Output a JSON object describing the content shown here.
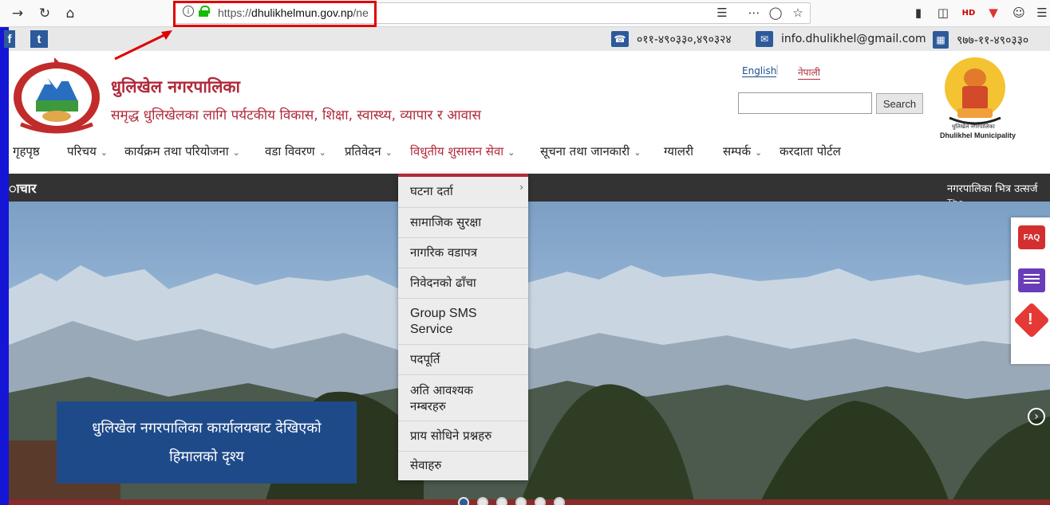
{
  "browser": {
    "url_scheme": "https://",
    "url_host": "dhulikhelmun.gov.np",
    "url_rest": "/ne",
    "back_icon": "arrow-right-icon",
    "reload_icon": "reload-icon",
    "home_icon": "home-icon"
  },
  "top_strip": {
    "facebook": "f",
    "twitter": "t",
    "phone": "०११-४९०३३०,४९०३२४",
    "email": "info.dhulikhel@gmail.com",
    "fax": "९७७-११-४९०३३०"
  },
  "header": {
    "title": "धुलिखेल नगरपालिका",
    "tagline": "समृद्ध धुलिखेलका लागि पर्यटकीय विकास, शिक्षा, स्वास्थ्य, व्यापार र आवास",
    "lang_en": "English",
    "lang_sep": "|",
    "lang_np": "नेपाली",
    "search_button": "Search",
    "logo_np": "धुलिखेल नगरपालिका",
    "logo_en": "Dhulikhel Municipality"
  },
  "nav": {
    "items": [
      {
        "label": "गृहपृष्ठ",
        "has_sub": false
      },
      {
        "label": "परिचय",
        "has_sub": true
      },
      {
        "label": "कार्यक्रम तथा परियोजना",
        "has_sub": true
      },
      {
        "label": "वडा विवरण",
        "has_sub": true
      },
      {
        "label": "प्रतिवेदन",
        "has_sub": true
      },
      {
        "label": "विधुतीय शुसासन सेवा",
        "has_sub": true,
        "active": true
      },
      {
        "label": "सूचना तथा जानकारी",
        "has_sub": true
      },
      {
        "label": "ग्यालरी",
        "has_sub": false
      },
      {
        "label": "सम्पर्क",
        "has_sub": true
      },
      {
        "label": "करदाता पोर्टल",
        "has_sub": false
      }
    ],
    "chevron": "⌄"
  },
  "ticker": {
    "left_text": "ाचार",
    "right_text": "नगरपालिका भित्र उत्सर्ज",
    "right_text2": "The ... ... ... ... ..."
  },
  "dropdown": {
    "items": [
      {
        "label": "घटना दर्ता",
        "has_sub": true
      },
      {
        "label": "सामाजिक सुरक्षा"
      },
      {
        "label": "नागरिक वडापत्र"
      },
      {
        "label": "निवेदनको ढाँचा"
      },
      {
        "label": "Group SMS Service"
      },
      {
        "label": "पदपूर्ति"
      },
      {
        "label": "अति आवश्यक नम्बरहरु"
      },
      {
        "label": "प्राय सोधिने प्रश्नहरु"
      },
      {
        "label": "सेवाहरु"
      }
    ]
  },
  "hero": {
    "caption_line1": "धुलिखेल नगरपालिका कार्यालयबाट देखिएको",
    "caption_line2": "हिमालको दृश्य",
    "slide_count": 6,
    "active_slide": 1
  },
  "side_widgets": {
    "faq_label": "FAQ",
    "alert_mark": "!"
  },
  "colors": {
    "brand_red": "#b02a3a",
    "brand_blue": "#2c5a9b",
    "caption_blue": "#1f4a8a",
    "annotation_red": "#e00000"
  }
}
